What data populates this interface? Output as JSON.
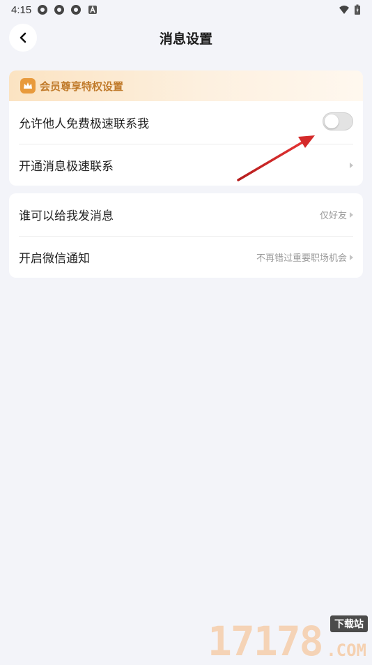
{
  "status_bar": {
    "time": "4:15",
    "icons": [
      "app-notification-icon",
      "app-notification-icon",
      "app-notification-icon",
      "a-badge-icon"
    ],
    "right_icons": [
      "wifi-icon",
      "battery-icon"
    ]
  },
  "header": {
    "title": "消息设置",
    "back_icon": "back-chevron-icon"
  },
  "card1": {
    "vip_banner": "会员尊享特权设置",
    "rows": [
      {
        "label": "允许他人免费极速联系我",
        "toggle_on": false
      },
      {
        "label": "开通消息极速联系"
      }
    ]
  },
  "card2": {
    "rows": [
      {
        "label": "谁可以给我发消息",
        "value": "仅好友"
      },
      {
        "label": "开启微信通知",
        "value": "不再错过重要职场机会"
      }
    ]
  },
  "watermark": {
    "digits": "17178",
    "tag": "下载站",
    "com": ".COM"
  },
  "colors": {
    "background": "#f3f4f9",
    "vip_accent": "#c07a2a",
    "annotation_arrow": "#d42a2a"
  }
}
